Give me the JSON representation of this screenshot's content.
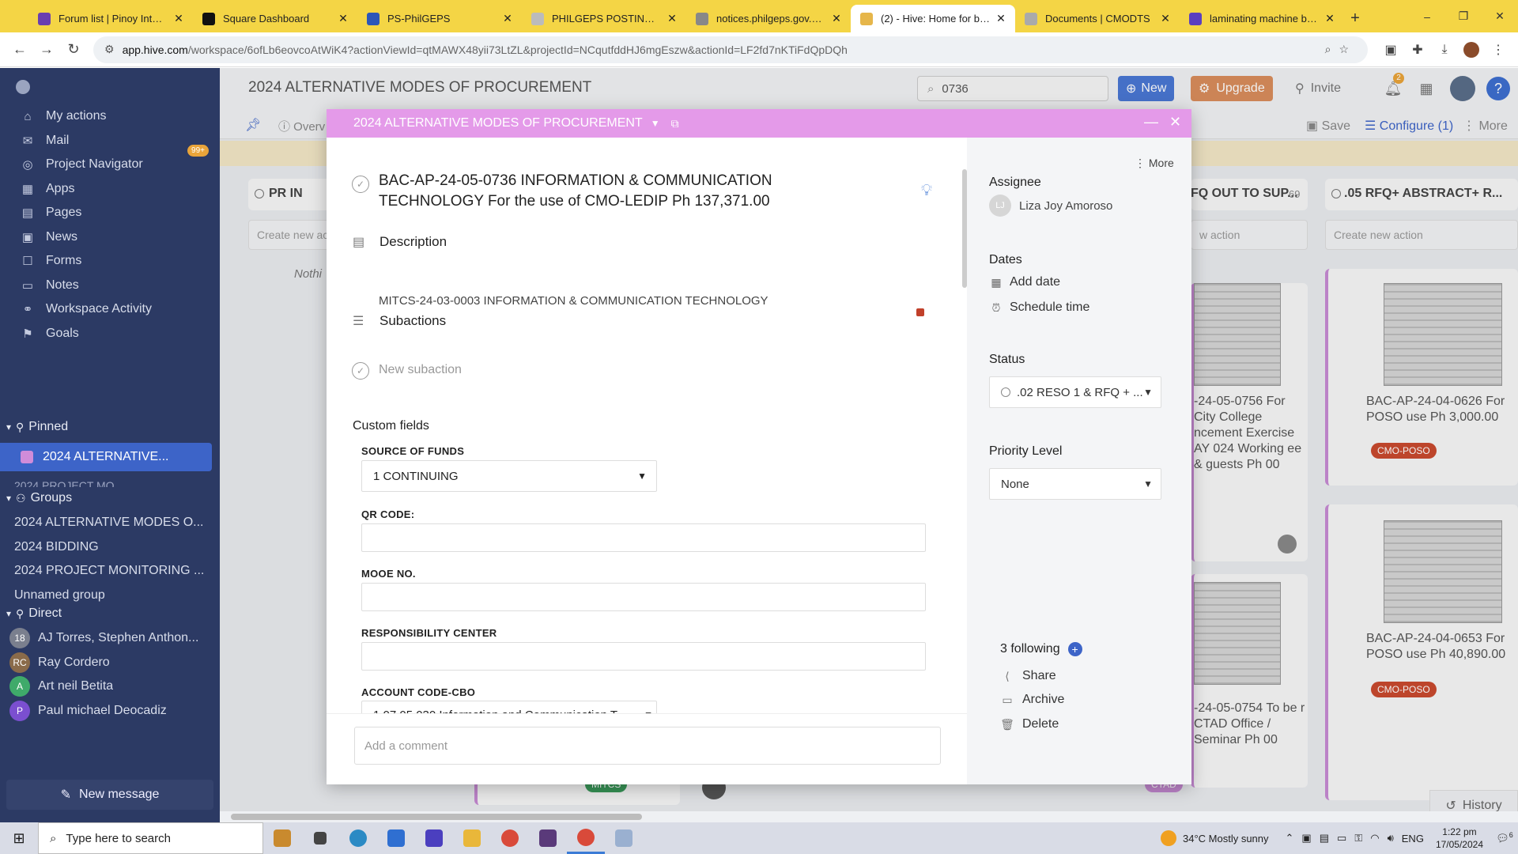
{
  "browser": {
    "tabs": [
      {
        "label": "Forum list | Pinoy Internet",
        "fav": "#6a3fb0",
        "active": false
      },
      {
        "label": "Square Dashboard",
        "fav": "#111111",
        "active": false
      },
      {
        "label": "PS-PhilGEPS",
        "fav": "#2c56b8",
        "active": false
      },
      {
        "label": "PHILGEPS POSTING OR OTHER",
        "fav": "#bbbbbb",
        "active": false
      },
      {
        "label": "notices.philgeps.gov.ph/G",
        "fav": "#888888",
        "active": false
      },
      {
        "label": "(2) - Hive: Home for busy",
        "fav": "#e6b64a",
        "active": true
      },
      {
        "label": "Documents | CMODTS",
        "fav": "#aaaaaa",
        "active": false
      },
      {
        "label": "laminating machine bran",
        "fav": "#5b3fbf",
        "active": false
      }
    ],
    "close_glyph": "✕",
    "new_tab": "+",
    "url_host": "app.hive.com",
    "url_path": "/workspace/6ofLb6eovcoAtWiK4?actionViewId=qtMAWX48yii73LtZL&projectId=NCqutfddHJ6mgEszw&actionId=LF2fd7nKTiFdQpDQh",
    "window_controls": [
      "–",
      "❐",
      "✕"
    ]
  },
  "sidebar": {
    "items": [
      {
        "label": "My actions",
        "icon": "⌂"
      },
      {
        "label": "Mail",
        "icon": "✉"
      },
      {
        "label": "Project Navigator",
        "icon": "◎"
      },
      {
        "label": "Apps",
        "icon": "▦"
      },
      {
        "label": "Pages",
        "icon": "▤"
      },
      {
        "label": "News",
        "icon": "▣"
      },
      {
        "label": "Forms",
        "icon": "☐"
      },
      {
        "label": "Notes",
        "icon": "▭"
      },
      {
        "label": "Workspace Activity",
        "icon": "⚭"
      },
      {
        "label": "Goals",
        "icon": "⚑"
      }
    ],
    "mail_badge": "99+",
    "pinned_label": "Pinned",
    "pinned_active": "2024 ALTERNATIVE...",
    "pinned_next": "2024 PROJECT MO",
    "groups_label": "Groups",
    "groups": [
      "2024 ALTERNATIVE MODES O...",
      "2024 BIDDING",
      "2024 PROJECT MONITORING ...",
      "Unnamed group"
    ],
    "direct_label": "Direct",
    "direct": [
      {
        "name": "AJ Torres, Stephen Anthon...",
        "initials": "18",
        "color": "#7a7f8e"
      },
      {
        "name": "Ray Cordero",
        "initials": "RC",
        "color": "#8a6b4a"
      },
      {
        "name": "Art neil Betita",
        "initials": "A",
        "color": "#3faa6a"
      },
      {
        "name": "Paul michael Deocadiz",
        "initials": "P",
        "color": "#7b4fd0"
      }
    ],
    "new_message": "New message"
  },
  "header": {
    "title": "2024 ALTERNATIVE MODES OF PROCUREMENT",
    "search_value": "0736",
    "new_label": "New",
    "upgrade_label": "Upgrade",
    "invite_label": "Invite",
    "notif_count": "2",
    "save_label": "Save",
    "configure_label": "Configure (1)",
    "more_label": "More",
    "overview_label": "Overv"
  },
  "board": {
    "col1_title": "PR IN",
    "col1_create": "Create new ac",
    "col1_empty": "Nothi",
    "col3_title": "FQ OUT TO SUP...",
    "col3_count": "69",
    "col3_create": "w action",
    "col4_title": ".05 RFQ+ ABSTRACT+ R...",
    "col4_create": "Create new action",
    "card_a": "-24-05-0756 For City College ncement Exercise AY 024 Working ee & guests Ph 00",
    "card_b": "-24-05-0754 To be r CTAD Office / Seminar Ph 00",
    "card_c": "BAC-AP-24-04-0626 For POSO use Ph 3,000.00",
    "card_d": "BAC-AP-24-04-0653 For POSO use Ph 40,890.00",
    "tag_poso": "CMO-POSO",
    "tag_mitcs": "MITCS",
    "tag_ctad": "CTAD",
    "history_label": "History"
  },
  "modal": {
    "project": "2024 ALTERNATIVE MODES OF PROCUREMENT",
    "title": "BAC-AP-24-05-0736  INFORMATION & COMMUNICATION TECHNOLOGY For the use of CMO-LEDIP  Ph 137,371.00",
    "description_label": "Description",
    "description": "MITCS-24-03-0003  INFORMATION & COMMUNICATION TECHNOLOGY",
    "subactions_label": "Subactions",
    "new_subaction": "New subaction",
    "custom_fields_label": "Custom fields",
    "fields": {
      "source_label": "SOURCE OF FUNDS",
      "source_value": "1 CONTINUING",
      "qr_label": "QR CODE:",
      "mooe_label": "MOOE NO.",
      "resp_label": "RESPONSIBILITY CENTER",
      "acct_label": "ACCOUNT CODE-CBO",
      "acct_value": "1 07 05 030 Information and Communication T..."
    },
    "comment_placeholder": "Add a comment",
    "right": {
      "more": "More",
      "assignee_label": "Assignee",
      "assignee_name": "Liza Joy Amoroso",
      "assignee_initials": "LJ",
      "dates_label": "Dates",
      "add_date": "Add date",
      "schedule_time": "Schedule time",
      "status_label": "Status",
      "status_value": ".02 RESO 1 & RFQ + ...",
      "priority_label": "Priority Level",
      "priority_value": "None",
      "following": "3 following",
      "share": "Share",
      "archive": "Archive",
      "delete": "Delete"
    }
  },
  "taskbar": {
    "search_placeholder": "Type here to search",
    "weather": "34°C  Mostly sunny",
    "lang": "ENG",
    "time": "1:22 pm",
    "date": "17/05/2024",
    "notif_count": "6"
  }
}
